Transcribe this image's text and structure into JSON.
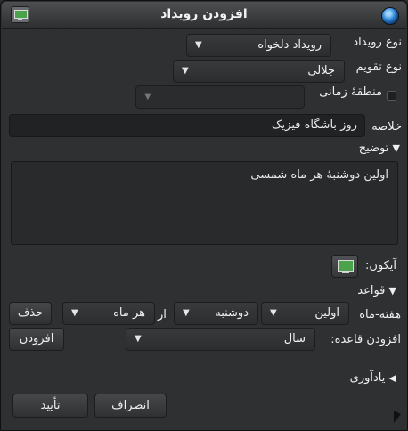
{
  "window": {
    "title": "افزودن رویداد"
  },
  "icons": {
    "app": "calendar-board-icon",
    "close": "close-orb-icon",
    "cursor": "mouse-pointer-icon"
  },
  "form": {
    "event_type_label": "نوع رویداد",
    "event_type_value": "رویداد دلخواه",
    "calendar_type_label": "نوع تقویم",
    "calendar_type_value": "جلالی",
    "timezone_label": "منطقهٔ زمانی",
    "timezone_value": "",
    "summary_label": "خلاصه",
    "summary_value": "روز باشگاه فیزیک",
    "description_label": "توضیح",
    "description_value": "اولین دوشنبهٔ هر ماه شمسی",
    "icon_label": "آیکون:",
    "rules_label": "قواعد",
    "rule_type_label": "هفته-ماه",
    "rule_order_value": "اولین",
    "rule_weekday_value": "دوشنبه",
    "rule_from_label": "از",
    "rule_month_value": "هر ماه",
    "delete_button": "حذف",
    "add_rule_label": "افزودن قاعده:",
    "add_rule_value": "سال",
    "add_button": "افزودن",
    "reminder_label": "یادآوری",
    "cancel_button": "انصراف",
    "ok_button": "تأیید"
  }
}
